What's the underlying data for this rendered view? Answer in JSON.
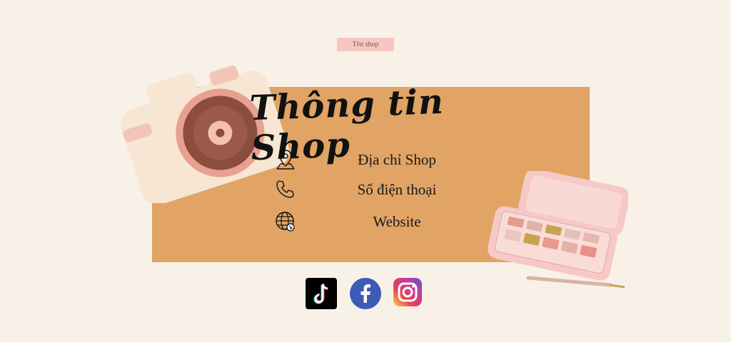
{
  "shop_tag": "Tên shop",
  "title": "Thông tin Shop",
  "info": {
    "address_label": "Địa chỉ Shop",
    "phone_label": "Số điện thoại",
    "website_label": "Website"
  },
  "icons": {
    "address": "map-pin-icon",
    "phone": "phone-icon",
    "website": "globe-icon",
    "social": [
      "tiktok-icon",
      "facebook-icon",
      "instagram-icon"
    ]
  },
  "colors": {
    "background": "#f8f1e8",
    "panel": "#e1a465",
    "tag": "#f7c6c2",
    "facebook": "#3b5bb5",
    "tiktok": "#000000"
  }
}
